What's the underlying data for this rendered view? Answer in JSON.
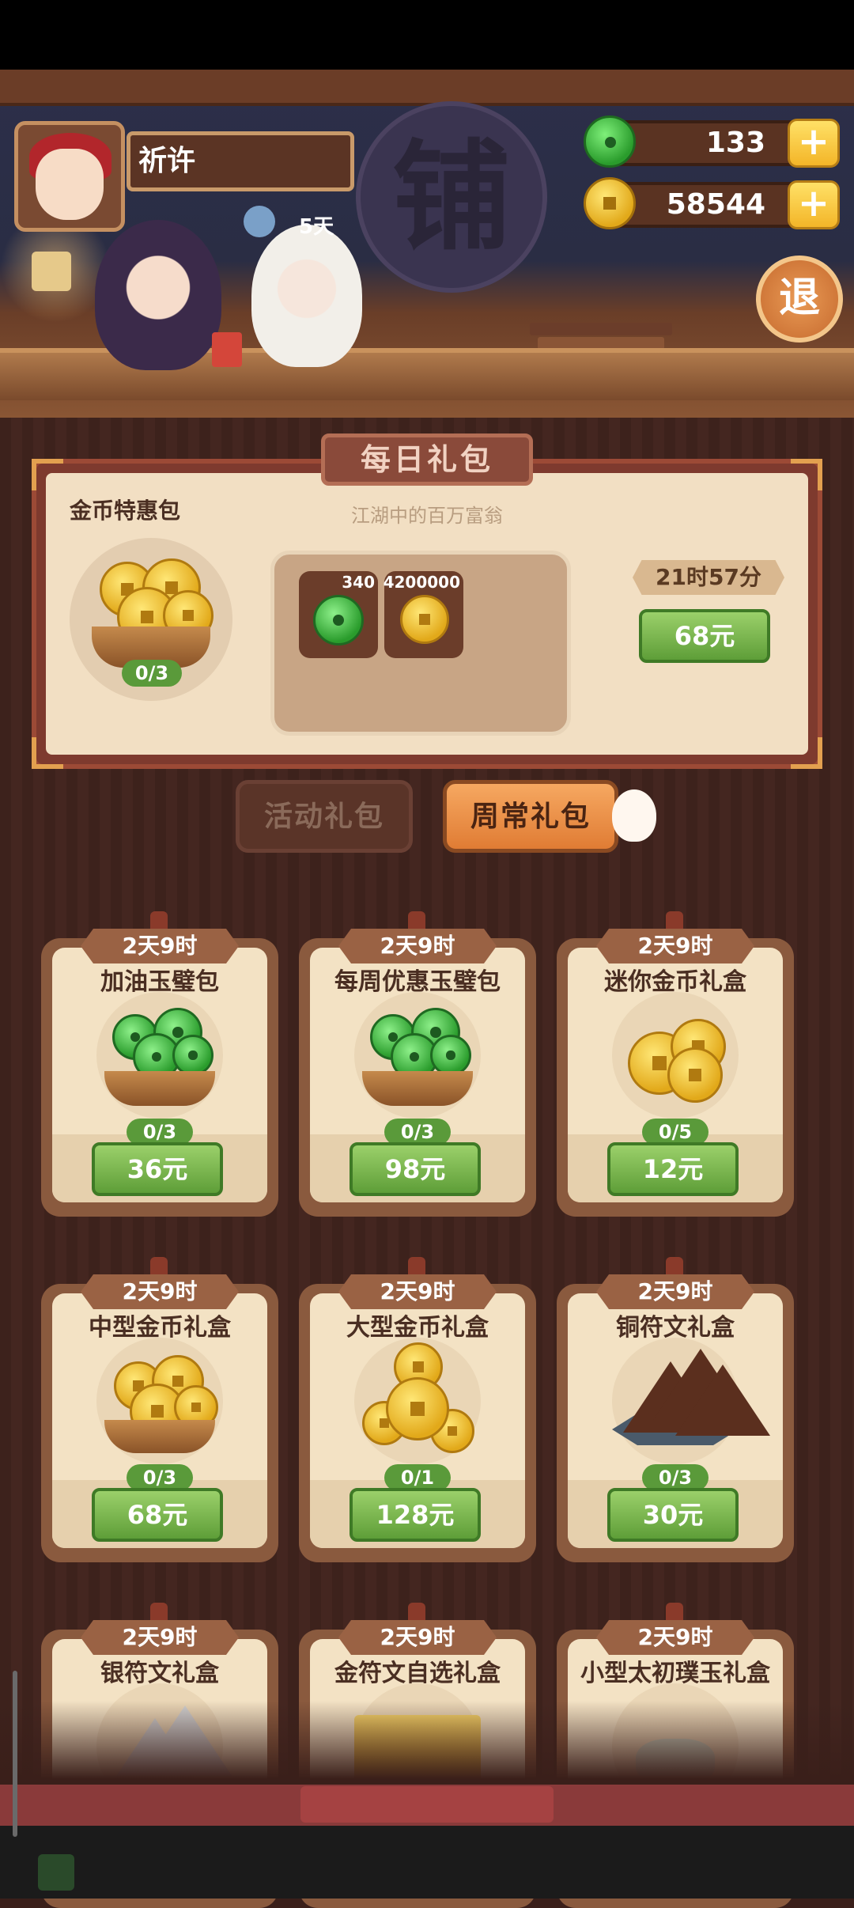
{
  "header": {
    "player_name": "祈许",
    "shop_sign": "铺",
    "pet_days": "5天",
    "jade_amount": "133",
    "coin_amount": "58544",
    "exit_label": "退",
    "plus_label": "+"
  },
  "daily": {
    "title": "每日礼包",
    "subtitle": "江湖中的百万富翁",
    "pack_name": "金币特惠包",
    "count": "0/3",
    "rewards": [
      {
        "icon": "jade-icon",
        "amount": "340"
      },
      {
        "icon": "coin-icon",
        "amount": "4200000"
      }
    ],
    "timer": "21时57分",
    "price": "68元"
  },
  "tabs": {
    "activity": "活动礼包",
    "regular": "周常礼包"
  },
  "cards": [
    {
      "timer": "2天9时",
      "title": "加油玉璧包",
      "count": "0/3",
      "price": "36元",
      "icon": "jade-basket-icon"
    },
    {
      "timer": "2天9时",
      "title": "每周优惠玉璧包",
      "count": "0/3",
      "price": "98元",
      "icon": "jade-basket-icon"
    },
    {
      "timer": "2天9时",
      "title": "迷你金币礼盒",
      "count": "0/5",
      "price": "12元",
      "icon": "coin-pile-icon"
    },
    {
      "timer": "2天9时",
      "title": "中型金币礼盒",
      "count": "0/3",
      "price": "68元",
      "icon": "coin-basket-icon"
    },
    {
      "timer": "2天9时",
      "title": "大型金币礼盒",
      "count": "0/1",
      "price": "128元",
      "icon": "coin-chest-icon"
    },
    {
      "timer": "2天9时",
      "title": "铜符文礼盒",
      "count": "0/3",
      "price": "30元",
      "icon": "copper-rune-icon"
    },
    {
      "timer": "2天9时",
      "title": "银符文礼盒",
      "icon": "silver-rune-icon"
    },
    {
      "timer": "2天9时",
      "title": "金符文自选礼盒",
      "icon": "gold-rune-icon"
    },
    {
      "timer": "2天9时",
      "title": "小型太初璞玉礼盒",
      "icon": "raw-jade-icon"
    }
  ]
}
